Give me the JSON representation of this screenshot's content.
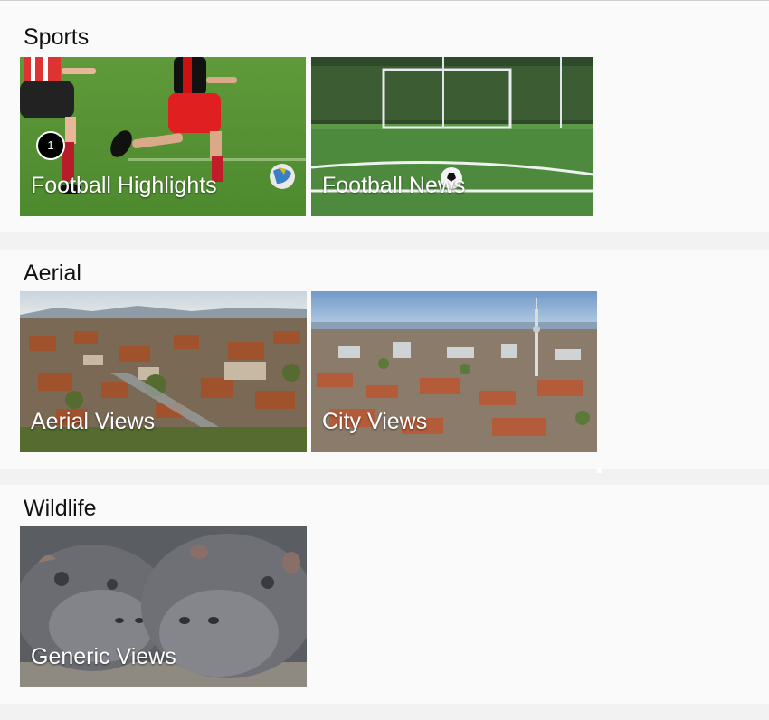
{
  "sections": [
    {
      "title": "Sports",
      "tiles": [
        {
          "label": "Football Highlights",
          "badge": "1"
        },
        {
          "label": "Football News"
        }
      ]
    },
    {
      "title": "Aerial",
      "tiles": [
        {
          "label": "Aerial Views"
        },
        {
          "label": "City Views"
        }
      ]
    },
    {
      "title": "Wildlife",
      "tiles": [
        {
          "label": "Generic Views"
        }
      ]
    }
  ],
  "colors": {
    "page_bg": "#f2f2f2",
    "section_bg": "#fafafa",
    "label_text": "#ffffff"
  }
}
